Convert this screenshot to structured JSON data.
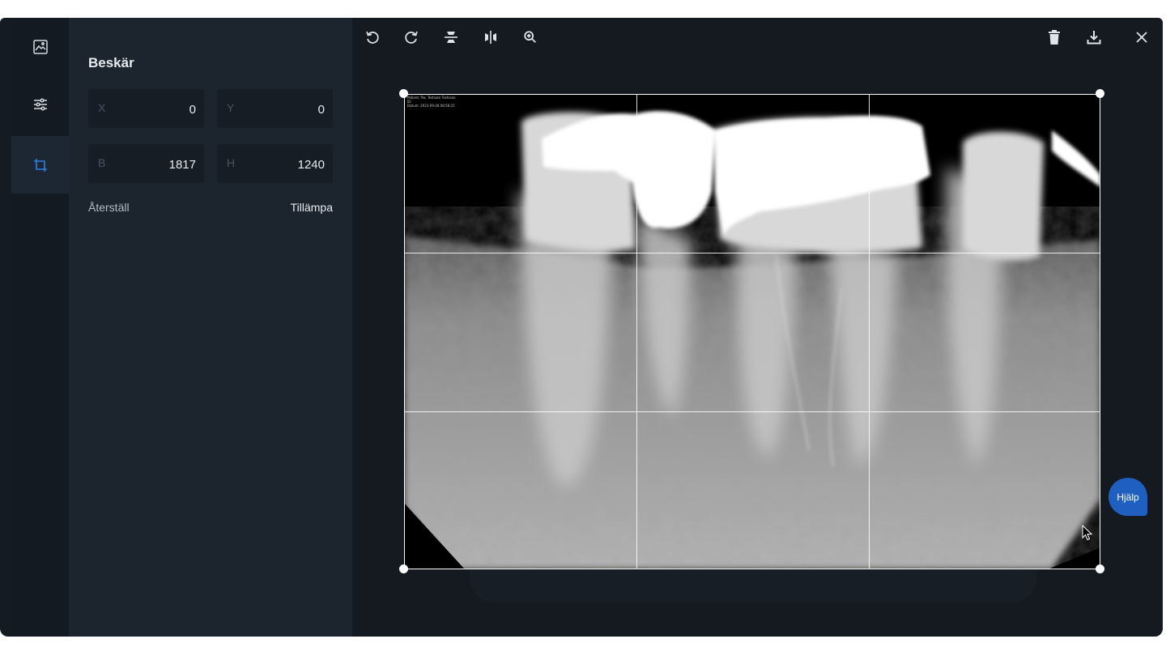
{
  "rail": {
    "items": [
      {
        "id": "image",
        "icon": "image-icon"
      },
      {
        "id": "adjust",
        "icon": "sliders-icon"
      },
      {
        "id": "crop",
        "icon": "crop-icon",
        "active": true
      }
    ]
  },
  "panel": {
    "title": "Beskär",
    "fields": {
      "x": {
        "label": "X",
        "value": "0"
      },
      "y": {
        "label": "Y",
        "value": "0"
      },
      "w": {
        "label": "B",
        "value": "1817"
      },
      "h": {
        "label": "H",
        "value": "1240"
      }
    },
    "reset_label": "Återställ",
    "apply_label": "Tillämpa"
  },
  "toolbar": {
    "left": [
      "rotate-left-icon",
      "rotate-right-icon",
      "flip-vertical-icon",
      "flip-horizontal-icon",
      "zoom-in-icon"
    ],
    "right": [
      "trash-icon",
      "download-icon",
      "close-icon"
    ]
  },
  "image": {
    "overlay_lines": [
      "Patient: Pia, Testsam Testsson",
      "ID:",
      "Datum: 2023-09-28 08:58:25"
    ]
  },
  "help": {
    "label": "Hjälp"
  },
  "colors": {
    "accent": "#1e5fc0",
    "active_icon": "#2f7fe0",
    "panel": "#1c242e",
    "main": "#141a20"
  }
}
